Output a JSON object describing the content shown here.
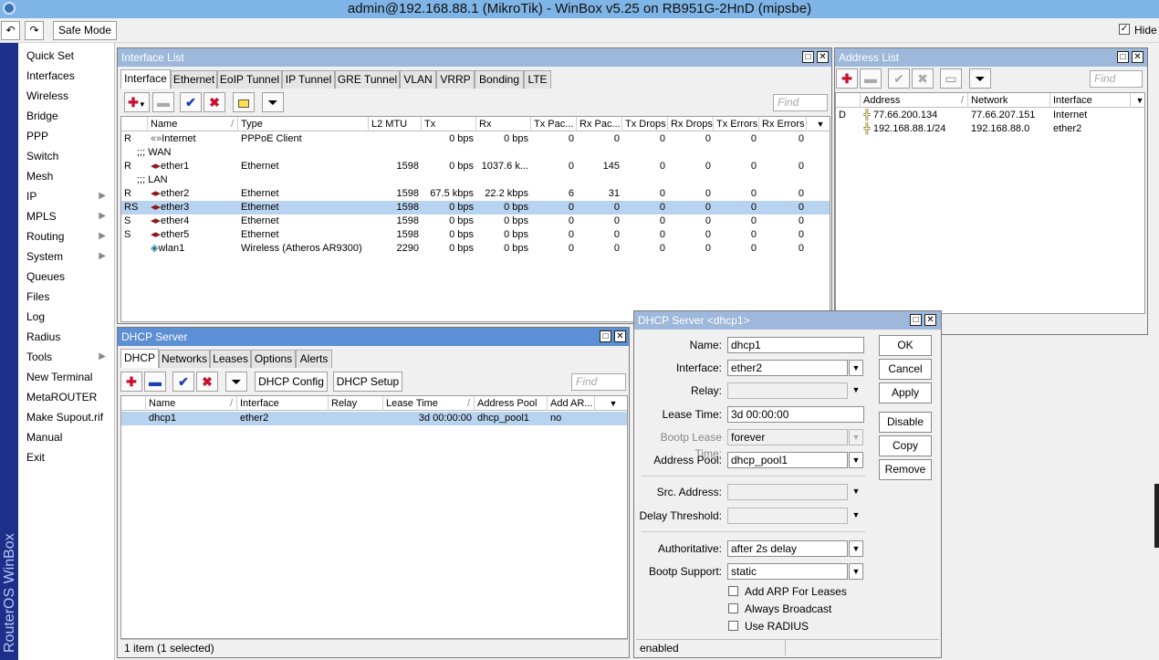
{
  "app": {
    "title": "admin@192.168.88.1 (MikroTik) - WinBox v5.25 on RB951G-2HnD (mipsbe)"
  },
  "toolbar": {
    "undo": "↶",
    "redo": "↷",
    "safe_mode": "Safe Mode",
    "hide_label": "Hide",
    "hide_checked": "✓"
  },
  "brand": "RouterOS WinBox",
  "menu": {
    "items": [
      {
        "label": "Quick Set",
        "arrow": ""
      },
      {
        "label": "Interfaces",
        "arrow": ""
      },
      {
        "label": "Wireless",
        "arrow": ""
      },
      {
        "label": "Bridge",
        "arrow": ""
      },
      {
        "label": "PPP",
        "arrow": ""
      },
      {
        "label": "Switch",
        "arrow": ""
      },
      {
        "label": "Mesh",
        "arrow": ""
      },
      {
        "label": "IP",
        "arrow": "▶"
      },
      {
        "label": "MPLS",
        "arrow": "▶"
      },
      {
        "label": "Routing",
        "arrow": "▶"
      },
      {
        "label": "System",
        "arrow": "▶"
      },
      {
        "label": "Queues",
        "arrow": ""
      },
      {
        "label": "Files",
        "arrow": ""
      },
      {
        "label": "Log",
        "arrow": ""
      },
      {
        "label": "Radius",
        "arrow": ""
      },
      {
        "label": "Tools",
        "arrow": "▶"
      },
      {
        "label": "New Terminal",
        "arrow": ""
      },
      {
        "label": "MetaROUTER",
        "arrow": ""
      },
      {
        "label": "Make Supout.rif",
        "arrow": ""
      },
      {
        "label": "Manual",
        "arrow": ""
      },
      {
        "label": "Exit",
        "arrow": ""
      }
    ]
  },
  "iface": {
    "title": "Interface List",
    "tabs": [
      "Interface",
      "Ethernet",
      "EoIP Tunnel",
      "IP Tunnel",
      "GRE Tunnel",
      "VLAN",
      "VRRP",
      "Bonding",
      "LTE"
    ],
    "find": "Find",
    "columns": [
      "Name",
      "Type",
      "L2 MTU",
      "Tx",
      "Rx",
      "Tx Pac...",
      "Rx Pac...",
      "Tx Drops",
      "Rx Drops",
      "Tx Errors",
      "Rx Errors"
    ],
    "rows": [
      {
        "flag": "R",
        "name": "Internet",
        "type": "PPPoE Client",
        "mtu": "",
        "tx": "0 bps",
        "rx": "0 bps",
        "txp": "0",
        "rxp": "0",
        "txd": "0",
        "rxd": "0",
        "txe": "0",
        "rxe": "0"
      },
      {
        "comment": ";;; WAN"
      },
      {
        "flag": "R",
        "name": "ether1",
        "type": "Ethernet",
        "mtu": "1598",
        "tx": "0 bps",
        "rx": "1037.6 k...",
        "txp": "0",
        "rxp": "145",
        "txd": "0",
        "rxd": "0",
        "txe": "0",
        "rxe": "0"
      },
      {
        "comment": ";;; LAN"
      },
      {
        "flag": "R",
        "name": "ether2",
        "type": "Ethernet",
        "mtu": "1598",
        "tx": "67.5 kbps",
        "rx": "22.2 kbps",
        "txp": "6",
        "rxp": "31",
        "txd": "0",
        "rxd": "0",
        "txe": "0",
        "rxe": "0"
      },
      {
        "flag": "RS",
        "name": "ether3",
        "type": "Ethernet",
        "mtu": "1598",
        "tx": "0 bps",
        "rx": "0 bps",
        "txp": "0",
        "rxp": "0",
        "txd": "0",
        "rxd": "0",
        "txe": "0",
        "rxe": "0",
        "selected": true
      },
      {
        "flag": "S",
        "name": "ether4",
        "type": "Ethernet",
        "mtu": "1598",
        "tx": "0 bps",
        "rx": "0 bps",
        "txp": "0",
        "rxp": "0",
        "txd": "0",
        "rxd": "0",
        "txe": "0",
        "rxe": "0"
      },
      {
        "flag": "S",
        "name": "ether5",
        "type": "Ethernet",
        "mtu": "1598",
        "tx": "0 bps",
        "rx": "0 bps",
        "txp": "0",
        "rxp": "0",
        "txd": "0",
        "rxd": "0",
        "txe": "0",
        "rxe": "0"
      },
      {
        "flag": "",
        "name": "wlan1",
        "type": "Wireless (Atheros AR9300)",
        "mtu": "2290",
        "tx": "0 bps",
        "rx": "0 bps",
        "txp": "0",
        "rxp": "0",
        "txd": "0",
        "rxd": "0",
        "txe": "0",
        "rxe": "0"
      }
    ]
  },
  "addr": {
    "title": "Address List",
    "find": "Find",
    "columns": [
      "Address",
      "Network",
      "Interface"
    ],
    "rows": [
      {
        "flag": "D",
        "address": "77.66.200.134",
        "network": "77.66.207.151",
        "iface": "Internet"
      },
      {
        "flag": "",
        "address": "192.168.88.1/24",
        "network": "192.168.88.0",
        "iface": "ether2"
      }
    ]
  },
  "dhcp": {
    "title": "DHCP Server",
    "tabs": [
      "DHCP",
      "Networks",
      "Leases",
      "Options",
      "Alerts"
    ],
    "config_btn": "DHCP Config",
    "setup_btn": "DHCP Setup",
    "find": "Find",
    "columns": [
      "Name",
      "Interface",
      "Relay",
      "Lease Time",
      "Address Pool",
      "Add AR..."
    ],
    "rows": [
      {
        "name": "dhcp1",
        "iface": "ether2",
        "relay": "",
        "lease": "3d 00:00:00",
        "pool": "dhcp_pool1",
        "arp": "no"
      }
    ],
    "status": "1 item (1 selected)"
  },
  "dlg": {
    "title": "DHCP Server <dhcp1>",
    "labels": {
      "name": "Name:",
      "iface": "Interface:",
      "relay": "Relay:",
      "lease": "Lease Time:",
      "bootp_lease": "Bootp Lease Time:",
      "pool": "Address Pool:",
      "src": "Src. Address:",
      "delay": "Delay Threshold:",
      "auth": "Authoritative:",
      "bootp": "Bootp Support:"
    },
    "values": {
      "name": "dhcp1",
      "iface": "ether2",
      "relay": "",
      "lease": "3d 00:00:00",
      "bootp_lease": "forever",
      "pool": "dhcp_pool1",
      "src": "",
      "delay": "",
      "auth": "after 2s delay",
      "bootp": "static"
    },
    "checks": [
      "Add ARP For Leases",
      "Always Broadcast",
      "Use RADIUS"
    ],
    "buttons": [
      "OK",
      "Cancel",
      "Apply",
      "Disable",
      "Copy",
      "Remove"
    ],
    "status": "enabled"
  }
}
